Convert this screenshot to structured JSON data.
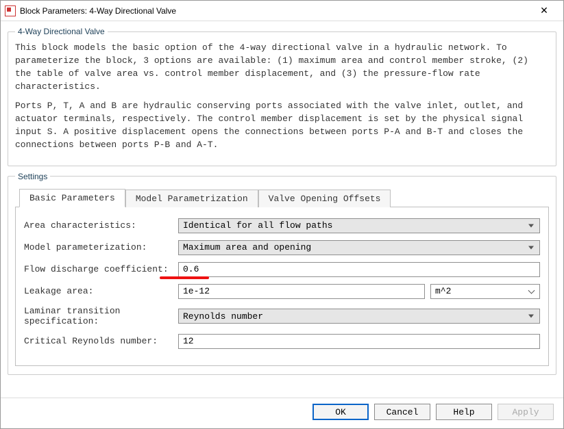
{
  "window": {
    "title": "Block Parameters: 4-Way Directional Valve"
  },
  "description": {
    "legend": "4-Way Directional Valve",
    "para1": "This block models the basic option of the 4-way directional valve in a hydraulic network. To parameterize the block, 3 options are available: (1) maximum area and control member stroke, (2) the table of valve area vs. control member displacement, and (3) the pressure-flow rate characteristics.",
    "para2": "Ports P, T, A and B are hydraulic conserving ports associated with the valve inlet, outlet, and actuator terminals, respectively. The control member displacement is set by the physical signal input S. A positive displacement opens the connections between ports P-A and B-T and closes the connections between ports P-B and A-T."
  },
  "settings": {
    "legend": "Settings",
    "tabs": [
      "Basic Parameters",
      "Model Parametrization",
      "Valve Opening Offsets"
    ],
    "active_tab": 0,
    "rows": {
      "area_char": {
        "label": "Area characteristics:",
        "value": "Identical for all flow paths"
      },
      "model_param": {
        "label": "Model parameterization:",
        "value": "Maximum area and opening"
      },
      "flow_disc": {
        "label": "Flow discharge coefficient:",
        "value": "0.6"
      },
      "leakage": {
        "label": "Leakage area:",
        "value": "1e-12",
        "unit": "m^2"
      },
      "laminar": {
        "label": "Laminar transition specification:",
        "value": "Reynolds number"
      },
      "crit_re": {
        "label": "Critical Reynolds number:",
        "value": "12"
      }
    }
  },
  "buttons": {
    "ok": "OK",
    "cancel": "Cancel",
    "help": "Help",
    "apply": "Apply"
  }
}
